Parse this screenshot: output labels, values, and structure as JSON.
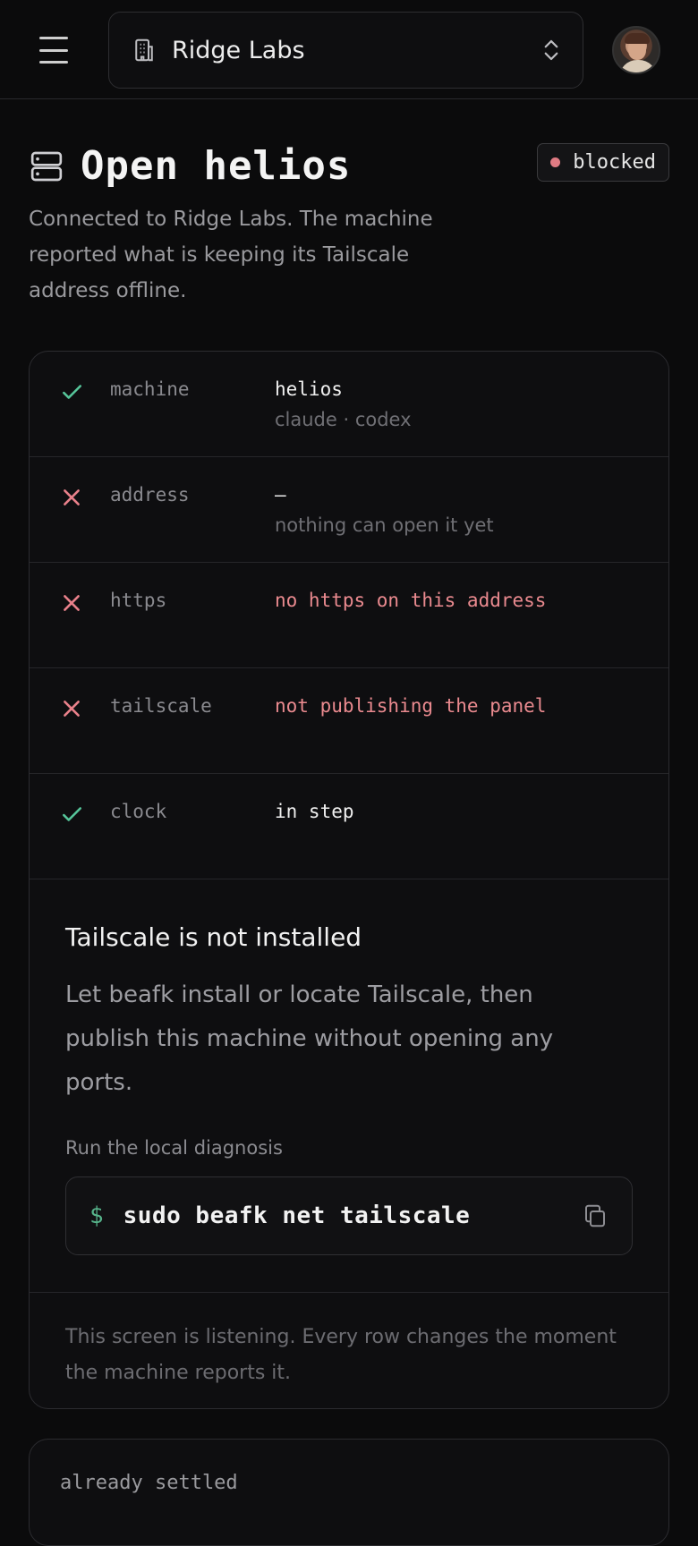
{
  "header": {
    "org_name": "Ridge Labs"
  },
  "page": {
    "title": "Open helios",
    "status": "blocked",
    "subtitle": "Connected to Ridge Labs. The machine reported what is keeping its Tailscale address offline."
  },
  "checks": [
    {
      "state": "ok",
      "key": "machine",
      "value": "helios",
      "sub": "claude · codex"
    },
    {
      "state": "fail",
      "key": "address",
      "value": "—",
      "sub": "nothing can open it yet"
    },
    {
      "state": "fail",
      "key": "https",
      "value": "no https on this address",
      "sub": ""
    },
    {
      "state": "fail",
      "key": "tailscale",
      "value": "not publishing the panel",
      "sub": ""
    },
    {
      "state": "ok",
      "key": "clock",
      "value": "in step",
      "sub": ""
    }
  ],
  "panel": {
    "heading": "Tailscale is not installed",
    "body": "Let beafk install or locate Tailscale, then publish this machine without opening any ports.",
    "hint": "Run the local diagnosis",
    "prompt": "$",
    "command": "sudo beafk net tailscale"
  },
  "footnote": "This screen is listening. Every row changes the moment the machine reports it.",
  "settled": {
    "label": "already settled"
  },
  "colors": {
    "ok": "#56c59a",
    "fail": "#e8808a",
    "background": "#0b0b0c"
  }
}
